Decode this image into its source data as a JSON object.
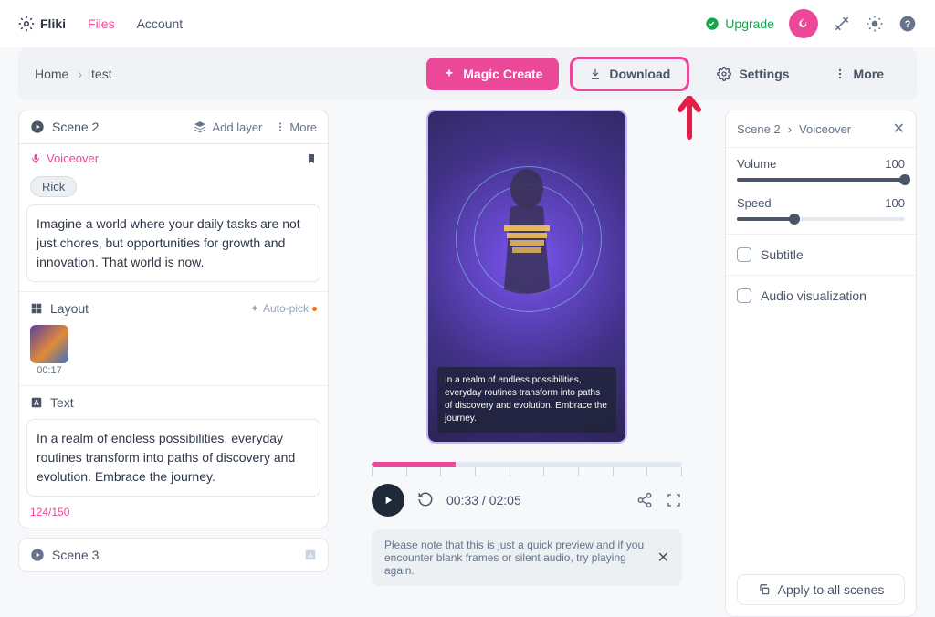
{
  "brand": "Fliki",
  "nav": {
    "files": "Files",
    "account": "Account"
  },
  "upgrade": "Upgrade",
  "breadcrumb": {
    "home": "Home",
    "current": "test"
  },
  "toolbar": {
    "magic": "Magic Create",
    "download": "Download",
    "settings": "Settings",
    "more": "More"
  },
  "scene2": {
    "title": "Scene 2",
    "add_layer": "Add layer",
    "more": "More",
    "voiceover_label": "Voiceover",
    "voice_chip": "Rick",
    "voiceover_text": "Imagine a world where your daily tasks are not just chores, but opportunities for growth and innovation. That world is now.",
    "layout_label": "Layout",
    "autopick": "Auto-pick",
    "thumb_time": "00:17",
    "text_label": "Text",
    "text_value": "In a realm of endless possibilities, everyday routines transform into paths of discovery and evolution. Embrace the journey.",
    "text_counter": "124/150"
  },
  "scene3": {
    "title": "Scene 3"
  },
  "preview": {
    "caption": "In a realm of endless possibilities, everyday routines transform into paths of discovery and evolution. Embrace the journey."
  },
  "player": {
    "current": "00:33",
    "total": "02:05"
  },
  "notice": "Please note that this is just a quick preview and if you encounter blank frames or silent audio, try playing again.",
  "right": {
    "crumb1": "Scene 2",
    "crumb2": "Voiceover",
    "volume_label": "Volume",
    "volume_value": "100",
    "speed_label": "Speed",
    "speed_value": "100",
    "subtitle": "Subtitle",
    "audiovis": "Audio visualization",
    "apply": "Apply to all scenes"
  }
}
